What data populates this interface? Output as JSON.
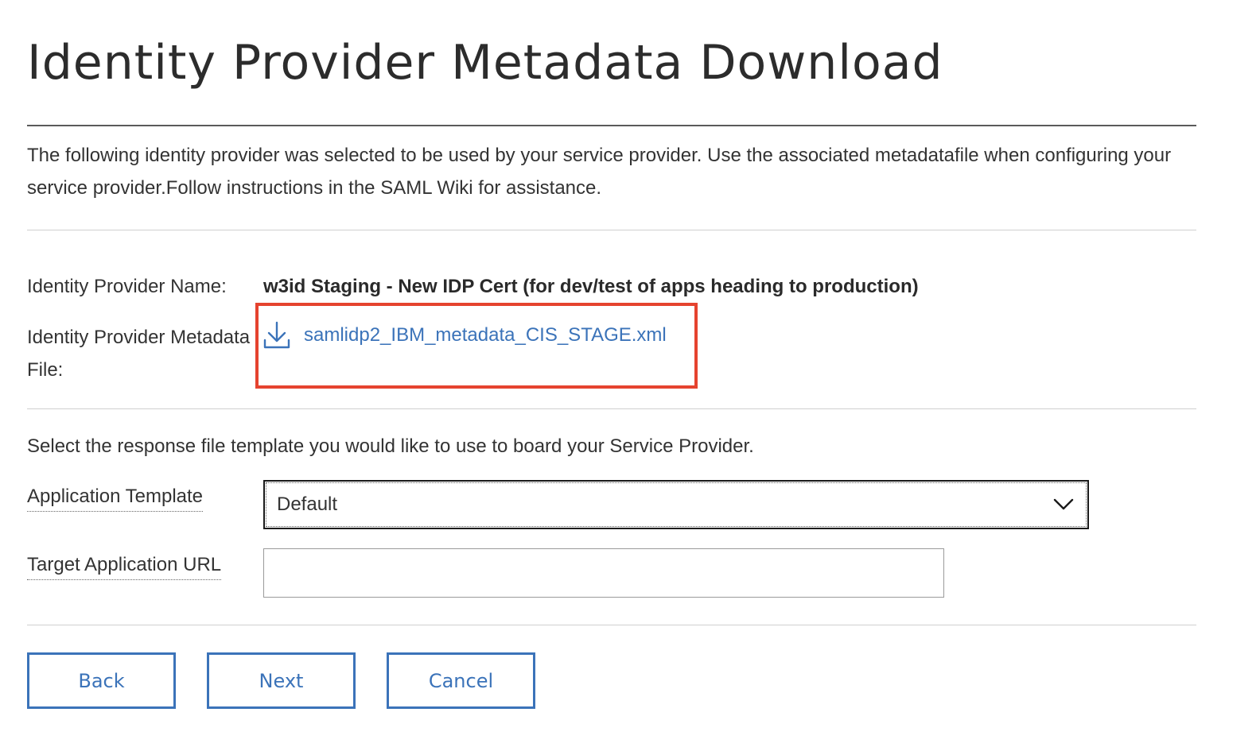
{
  "page": {
    "title": "Identity Provider Metadata Download",
    "intro": "The following identity provider was selected to be used by your service provider. Use the associated metadatafile when configuring your service provider.Follow instructions in the SAML Wiki for assistance."
  },
  "idp": {
    "name_label": "Identity Provider Name:",
    "name_value": "w3id Staging - New IDP Cert (for dev/test of apps heading to production)",
    "metadata_label": "Identity Provider Metadata File:",
    "metadata_file": "samlidp2_IBM_metadata_CIS_STAGE.xml",
    "download_icon": "download-icon"
  },
  "template": {
    "intro": "Select the response file template you would like to use to board your Service Provider.",
    "app_template_label": "Application Template",
    "app_template_value": "Default",
    "target_url_label": "Target Application URL",
    "target_url_value": ""
  },
  "buttons": {
    "back": "Back",
    "next": "Next",
    "cancel": "Cancel"
  },
  "colors": {
    "link": "#3b73b9",
    "highlight": "#e5432f"
  }
}
